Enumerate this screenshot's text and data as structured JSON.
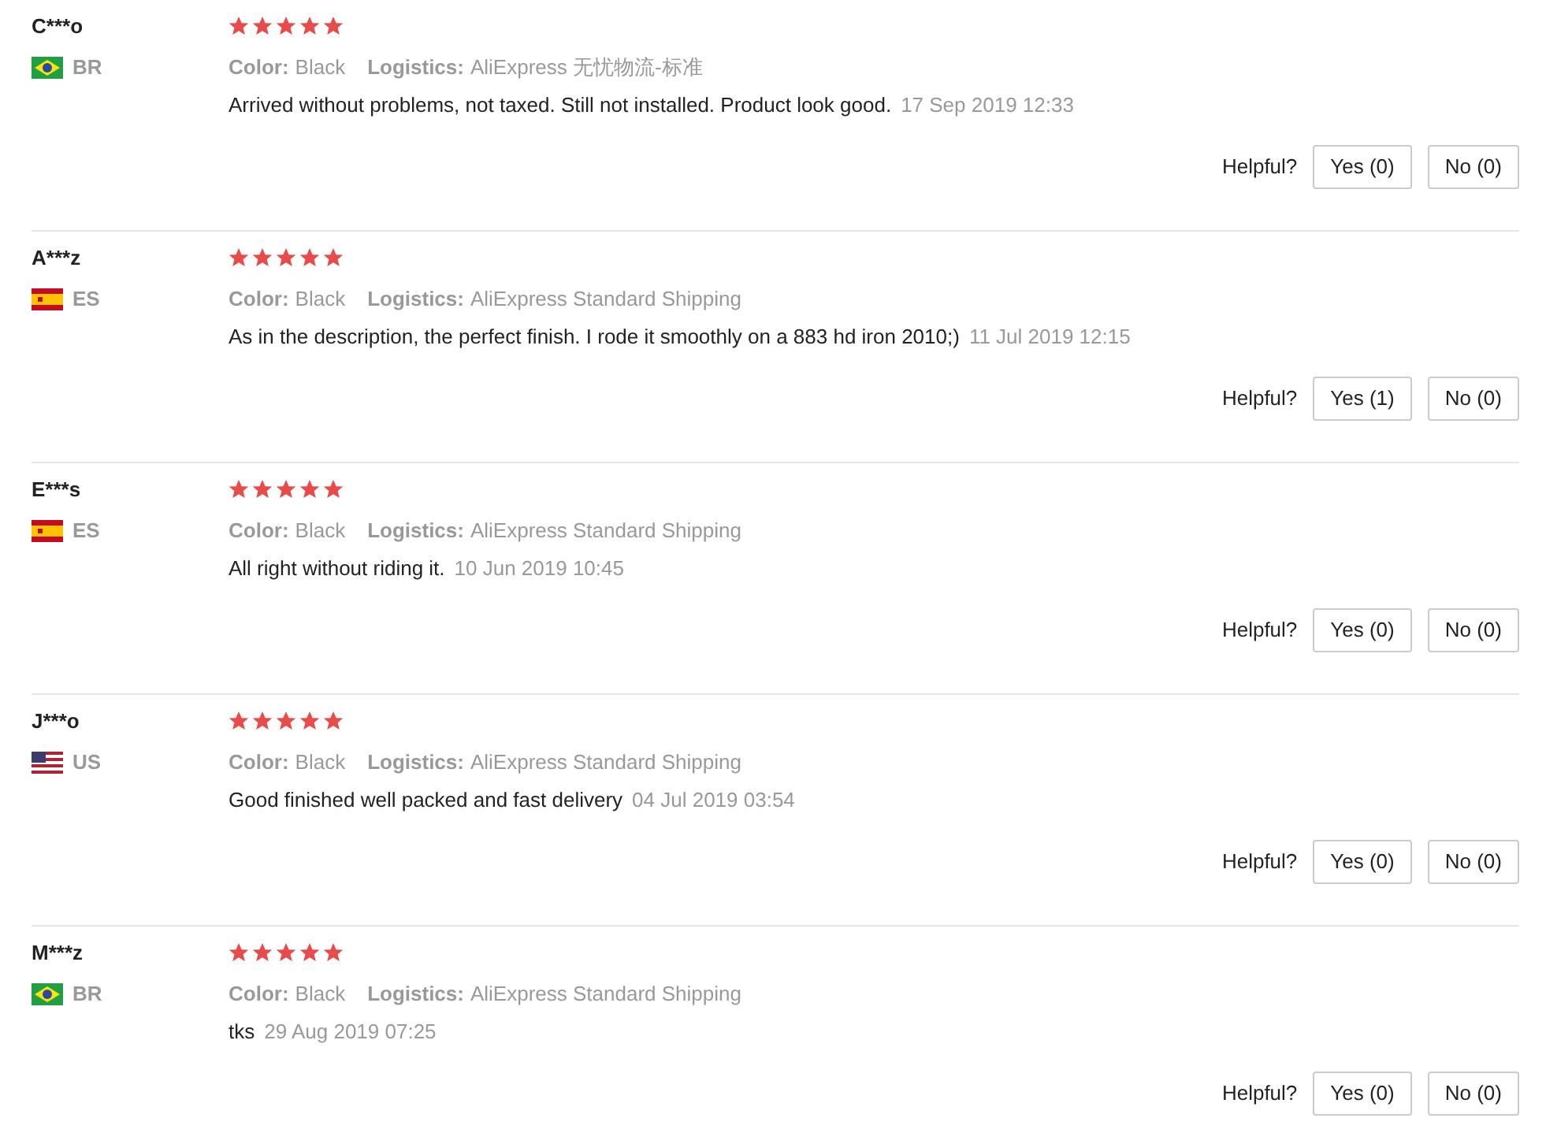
{
  "reviews": [
    {
      "name": "C***o",
      "country": {
        "kind": "br",
        "code": "BR"
      },
      "stars": 5,
      "color_label": "Color:",
      "color_value": "Black",
      "logistics_label": "Logistics:",
      "logistics_value": "AliExpress 无忧物流-标准",
      "text": "Arrived without problems, not taxed. Still not installed. Product look good.",
      "date": "17 Sep 2019 12:33",
      "helpful": "Helpful?",
      "yes": "Yes (0)",
      "no": "No (0)"
    },
    {
      "name": "A***z",
      "country": {
        "kind": "es",
        "code": "ES"
      },
      "stars": 5,
      "color_label": "Color:",
      "color_value": "Black",
      "logistics_label": "Logistics:",
      "logistics_value": "AliExpress Standard Shipping",
      "text": "As in the description, the perfect finish. I rode it smoothly on a 883 hd iron 2010;)",
      "date": "11 Jul 2019 12:15",
      "helpful": "Helpful?",
      "yes": "Yes (1)",
      "no": "No (0)"
    },
    {
      "name": "E***s",
      "country": {
        "kind": "es",
        "code": "ES"
      },
      "stars": 5,
      "color_label": "Color:",
      "color_value": "Black",
      "logistics_label": "Logistics:",
      "logistics_value": "AliExpress Standard Shipping",
      "text": "All right without riding it.",
      "date": "10 Jun 2019 10:45",
      "helpful": "Helpful?",
      "yes": "Yes (0)",
      "no": "No (0)"
    },
    {
      "name": "J***o",
      "country": {
        "kind": "us",
        "code": "US"
      },
      "stars": 5,
      "color_label": "Color:",
      "color_value": "Black",
      "logistics_label": "Logistics:",
      "logistics_value": "AliExpress Standard Shipping",
      "text": "Good finished well packed and fast delivery",
      "date": "04 Jul 2019 03:54",
      "helpful": "Helpful?",
      "yes": "Yes (0)",
      "no": "No (0)"
    },
    {
      "name": "M***z",
      "country": {
        "kind": "br",
        "code": "BR"
      },
      "stars": 5,
      "color_label": "Color:",
      "color_value": "Black",
      "logistics_label": "Logistics:",
      "logistics_value": "AliExpress Standard Shipping",
      "text": "tks",
      "date": "29 Aug 2019 07:25",
      "helpful": "Helpful?",
      "yes": "Yes (0)",
      "no": "No (0)"
    }
  ]
}
